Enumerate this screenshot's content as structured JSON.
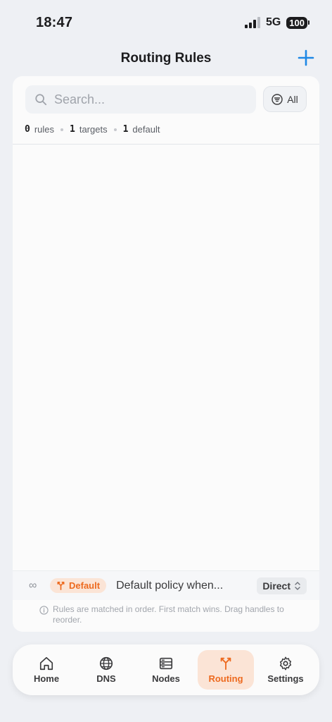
{
  "status": {
    "time": "18:47",
    "network": "5G",
    "battery": "100"
  },
  "header": {
    "title": "Routing Rules"
  },
  "search": {
    "placeholder": "Search...",
    "value": ""
  },
  "filter": {
    "label": "All"
  },
  "stats": [
    {
      "count": "0",
      "label": "rules"
    },
    {
      "count": "1",
      "label": "targets"
    },
    {
      "count": "1",
      "label": "default"
    }
  ],
  "default_rule": {
    "symbol": "∞",
    "badge": "Default",
    "description": "Default policy when...",
    "policy": "Direct"
  },
  "footnote": "Rules are matched in order. First match wins. Drag handles to reorder.",
  "tabs": [
    {
      "label": "Home",
      "icon": "home-icon"
    },
    {
      "label": "DNS",
      "icon": "globe-icon"
    },
    {
      "label": "Nodes",
      "icon": "server-icon"
    },
    {
      "label": "Routing",
      "icon": "routing-icon",
      "active": true
    },
    {
      "label": "Settings",
      "icon": "gear-icon"
    }
  ],
  "colors": {
    "accent_blue": "#1e88e5",
    "routing_orange": "#ed6a1f",
    "badge_bg": "#fbe4d6"
  }
}
